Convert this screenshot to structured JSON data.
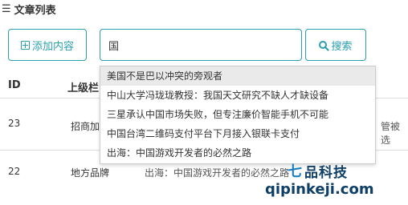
{
  "panel": {
    "icon": "menu-icon",
    "title": "文章列表"
  },
  "toolbar": {
    "add_label": "添加内容",
    "search_value": "国",
    "search_label": "搜索"
  },
  "table": {
    "headers": {
      "id": "ID",
      "parent": "上级栏"
    },
    "rows": [
      {
        "id": "23",
        "category": "招商加",
        "right": "管被选"
      },
      {
        "id": "22",
        "category": "地方品牌",
        "title": "出海：中国游戏开发者的必然之路"
      }
    ]
  },
  "suggestions": [
    "美国不是巴以冲突的旁观者",
    "中山大学冯珑珑教授：我国天文研究不缺人才缺设备",
    "三星承认中国市场失败，但专注廉价智能手机不可能",
    "中国台湾二维码支付平台下月接入银联卡支付",
    "出海：中国游戏开发者的必然之路"
  ],
  "watermark": {
    "text": "品科技",
    "logo": "七",
    "url": "qipinkeji.com"
  },
  "colors": {
    "accent": "#2a9fb0",
    "highlight": "#eaeaea"
  }
}
